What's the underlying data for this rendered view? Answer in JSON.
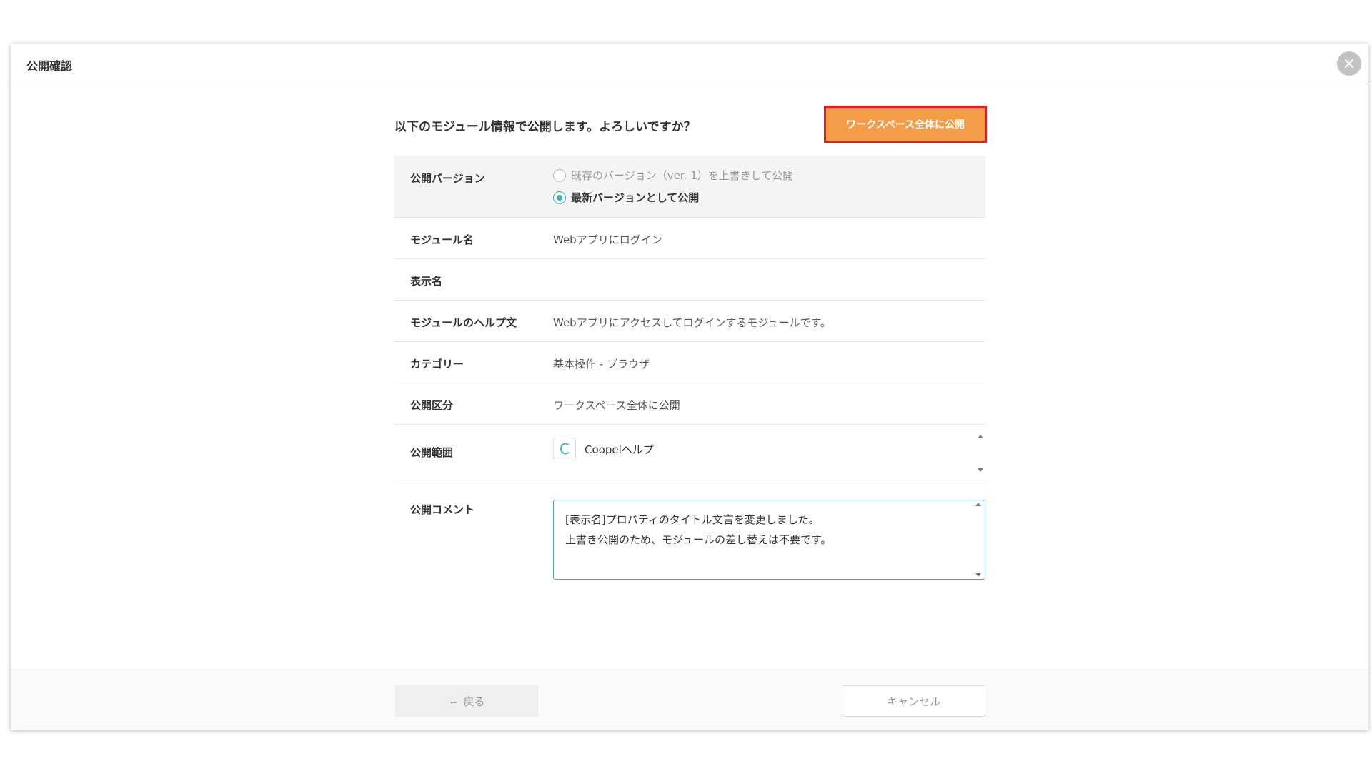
{
  "dialog": {
    "title": "公開確認",
    "question": "以下のモジュール情報で公開します。よろしいですか？",
    "publish_button": "ワークスペース全体に公開"
  },
  "version": {
    "label": "公開バージョン",
    "options": [
      {
        "label": "既存のバージョン（ver. 1）を上書きして公開",
        "selected": false
      },
      {
        "label": "最新バージョンとして公開",
        "selected": true
      }
    ]
  },
  "fields": [
    {
      "label": "モジュール名",
      "value": "Webアプリにログイン"
    },
    {
      "label": "表示名",
      "value": ""
    },
    {
      "label": "モジュールのヘルプ文",
      "value": "Webアプリにアクセスしてログインするモジュールです。"
    },
    {
      "label": "カテゴリー",
      "value": "基本操作 - ブラウザ"
    },
    {
      "label": "公開区分",
      "value": "ワークスペース全体に公開"
    }
  ],
  "scope": {
    "label": "公開範囲",
    "items": [
      {
        "logo_letter": "C",
        "name": "Coopelヘルプ"
      }
    ]
  },
  "comment": {
    "label": "公開コメント",
    "value": "[表示名]プロパティのタイトル文言を変更しました。\n上書き公開のため、モジュールの差し替えは不要です。"
  },
  "footer": {
    "back_arrow": "←",
    "back_label": "戻る",
    "cancel_label": "キャンセル"
  },
  "colors": {
    "accent": "#3bb3ac",
    "publish_button": "#f49d48",
    "highlight_border": "#e41e1e"
  }
}
